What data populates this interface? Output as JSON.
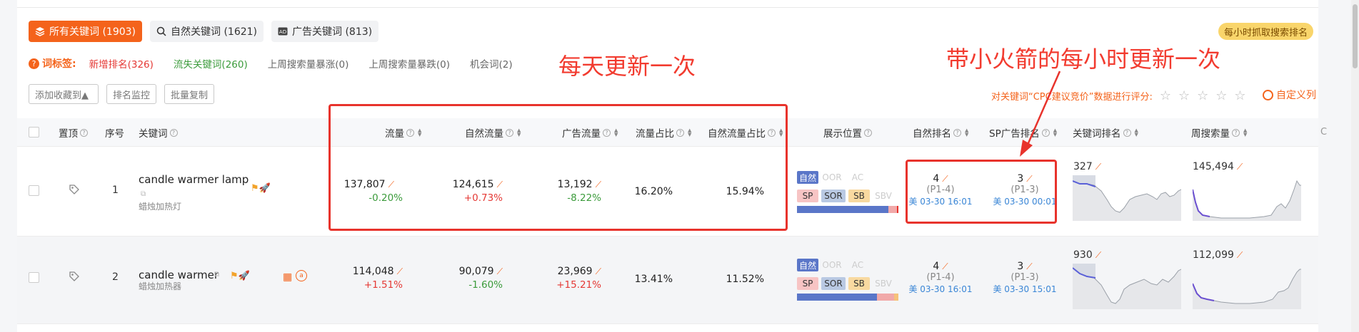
{
  "tabs": [
    {
      "label": "所有关键词 (1903)",
      "icon": "layers-icon",
      "active": true
    },
    {
      "label": "自然关键词 (1621)",
      "icon": "search-icon",
      "active": false
    },
    {
      "label": "广告关键词 (813)",
      "icon": "ad-icon",
      "active": false
    }
  ],
  "hourly_badge": "每小时抓取搜索排名",
  "tag_row": {
    "label": "词标签:",
    "tags": [
      {
        "text": "新增排名(326)",
        "color": "#e53935"
      },
      {
        "text": "流失关键词(260)",
        "color": "#3b9b3b"
      },
      {
        "text": "上周搜索量暴涨(0)",
        "color": "#666666"
      },
      {
        "text": "上周搜索量暴跌(0)",
        "color": "#666666"
      },
      {
        "text": "机会词(2)",
        "color": "#666666"
      }
    ]
  },
  "toolbar": {
    "add_favorite": "添加收藏到▲",
    "rank_monitor": "排名监控",
    "batch_copy": "批量复制"
  },
  "annotations": {
    "daily": "每天更新一次",
    "hourly": "带小火箭的每小时更新一次"
  },
  "rating": {
    "text": "对关键词“CPC建议竞价”数据进行评分:"
  },
  "custom_columns": "自定义列",
  "columns": {
    "pin": "置顶",
    "index": "序号",
    "keyword": "关键词",
    "traffic": "流量",
    "natural_traffic": "自然流量",
    "ad_traffic": "广告流量",
    "traffic_share": "流量占比",
    "natural_share": "自然流量占比",
    "placement": "展示位置",
    "natural_rank": "自然排名",
    "sp_rank": "SP广告排名",
    "keyword_rank": "关键词排名",
    "weekly_volume": "周搜索量"
  },
  "placement_labels": {
    "natural": "自然",
    "oor": "OOR",
    "ac": "AC",
    "sp": "SP",
    "sor": "SOR",
    "sb": "SB",
    "sbv": "SBV"
  },
  "rows": [
    {
      "index": "1",
      "keyword": "candle warmer lamp",
      "keyword_cn": "蜡烛加热灯",
      "traffic": "137,807",
      "traffic_change": "-0.20%",
      "natural_traffic": "124,615",
      "natural_change": "+0.73%",
      "ad_traffic": "13,192",
      "ad_change": "-8.22%",
      "traffic_share": "16.20%",
      "natural_share": "15.94%",
      "natural_rank": "4",
      "natural_rank_range": "(P1-4)",
      "natural_rank_time": "美 03-30 16:01",
      "sp_rank": "3",
      "sp_rank_range": "(P1-3)",
      "sp_rank_time": "美 03-30 00:01",
      "keyword_rank": "327",
      "weekly_volume": "145,494"
    },
    {
      "index": "2",
      "keyword": "candle warmer",
      "keyword_cn": "蜡烛加热器",
      "traffic": "114,048",
      "traffic_change": "+1.51%",
      "natural_traffic": "90,079",
      "natural_change": "-1.60%",
      "ad_traffic": "23,969",
      "ad_change": "+15.21%",
      "traffic_share": "13.41%",
      "natural_share": "11.52%",
      "natural_rank": "4",
      "natural_rank_range": "(P1-4)",
      "natural_rank_time": "美 03-30 16:01",
      "sp_rank": "3",
      "sp_rank_range": "(P1-3)",
      "sp_rank_time": "美 03-30 15:01",
      "keyword_rank": "930",
      "weekly_volume": "112,099"
    }
  ],
  "colors": {
    "accent": "#f4631b",
    "annotation_red": "#e8332c",
    "link_blue": "#3a86d6",
    "bar_blue": "#5a76c8"
  }
}
